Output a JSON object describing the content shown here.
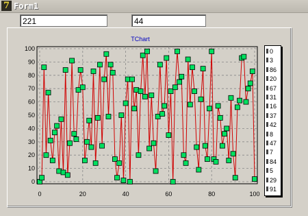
{
  "window": {
    "title": "Form1",
    "icon": "delphi-app-icon"
  },
  "inputs": {
    "field1_value": "221",
    "field2_value": "44"
  },
  "chart_data": {
    "type": "line",
    "title": "TChart",
    "xlim": [
      0,
      100
    ],
    "ylim": [
      0,
      100
    ],
    "grid": true,
    "legend_placement": "right",
    "series": [
      {
        "line_color": "#d00000",
        "marker_color": "#00e060",
        "x": [
          0,
          1,
          2,
          3,
          4,
          5,
          6,
          7,
          8,
          9,
          10,
          11,
          12,
          13,
          14,
          15,
          16,
          17,
          18,
          19,
          20,
          21,
          22,
          23,
          24,
          25,
          26,
          27,
          28,
          29,
          30,
          31,
          32,
          33,
          34,
          35,
          36,
          37,
          38,
          39,
          40,
          41,
          42,
          43,
          44,
          45,
          46,
          47,
          48,
          49,
          50,
          51,
          52,
          53,
          54,
          55,
          56,
          57,
          58,
          59,
          60,
          61,
          62,
          63,
          64,
          65,
          66,
          67,
          68,
          69,
          70,
          71,
          72,
          73,
          74,
          75,
          76,
          77,
          78,
          79,
          80,
          81,
          82,
          83,
          84,
          85,
          86,
          87,
          88,
          89,
          90,
          91,
          92,
          93,
          94,
          95,
          96,
          97,
          98,
          99,
          100
        ],
        "values": [
          0,
          3,
          86,
          20,
          67,
          31,
          16,
          37,
          42,
          8,
          47,
          7,
          84,
          5,
          29,
          91,
          36,
          32,
          69,
          84,
          71,
          16,
          30,
          46,
          26,
          83,
          14,
          48,
          88,
          27,
          77,
          96,
          49,
          88,
          82,
          17,
          3,
          14,
          50,
          1,
          59,
          77,
          0,
          77,
          55,
          69,
          20,
          68,
          95,
          64,
          98,
          25,
          65,
          29,
          8,
          49,
          88,
          51,
          57,
          93,
          35,
          68,
          0,
          71,
          98,
          75,
          79,
          20,
          14,
          92,
          58,
          86,
          68,
          26,
          9,
          62,
          85,
          27,
          17,
          55,
          98,
          17,
          15,
          57,
          48,
          27,
          36,
          40,
          16,
          63,
          21,
          3,
          56,
          61,
          93,
          94,
          60,
          70,
          74,
          83,
          2
        ]
      }
    ],
    "legend_values": [
      "0",
      "3",
      "86",
      "20",
      "67",
      "31",
      "16",
      "37",
      "42",
      "8",
      "47",
      "7",
      "84",
      "5",
      "29",
      "91"
    ],
    "x_ticks": [
      "0",
      "20",
      "40",
      "60",
      "80",
      "100"
    ],
    "y_ticks": [
      "0",
      "10",
      "20",
      "30",
      "40",
      "50",
      "60",
      "70",
      "80",
      "90",
      "100"
    ]
  }
}
